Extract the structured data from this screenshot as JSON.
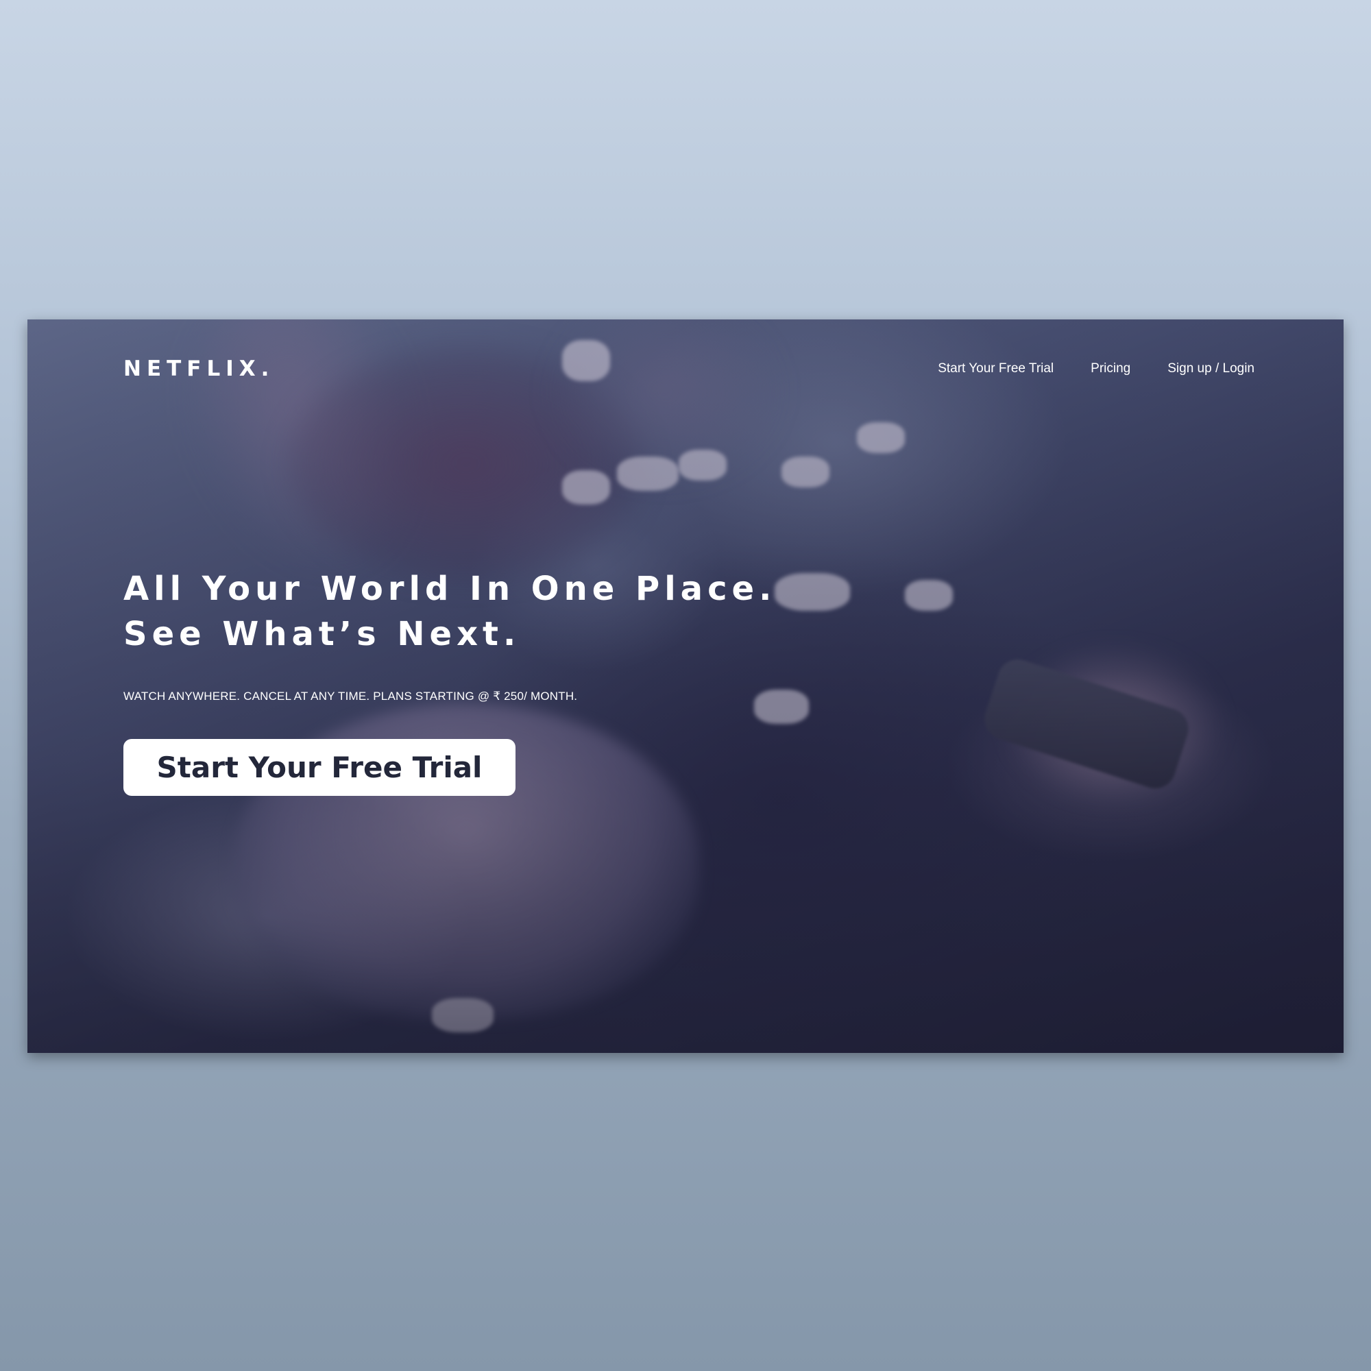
{
  "header": {
    "logo": "NETFLIX.",
    "nav_links": [
      {
        "label": "Start Your Free Trial"
      },
      {
        "label": "Pricing"
      },
      {
        "label": "Sign up / Login"
      }
    ]
  },
  "hero": {
    "headline_line1": "All Your World In One Place.",
    "headline_line2": "See What’s Next.",
    "subtext": "WATCH ANYWHERE. CANCEL AT ANY TIME. PLANS STARTING @ ₹ 250/ MONTH.",
    "cta_label": "Start Your Free Trial"
  },
  "colors": {
    "page_background": "#b3c3d6",
    "hero_overlay": "#2d3048",
    "text": "#ffffff",
    "cta_background": "#ffffff",
    "cta_text": "#23273a"
  }
}
